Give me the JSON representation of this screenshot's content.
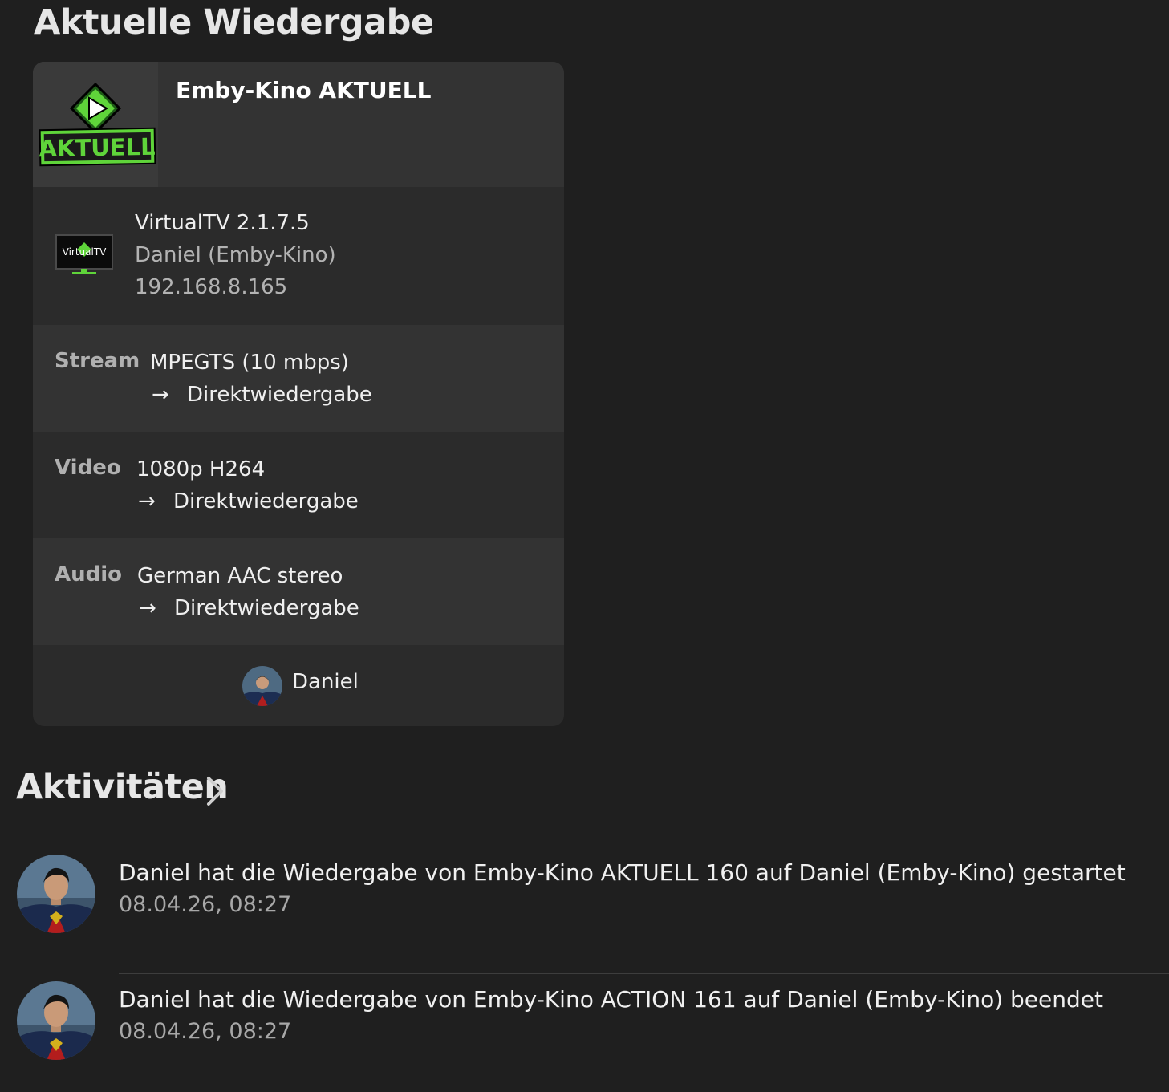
{
  "now_playing": {
    "section_title": "Aktuelle Wiedergabe",
    "item_title": "Emby-Kino AKTUELL",
    "thumb_text": "AKTUELL",
    "device": {
      "app": "VirtualTV 2.1.7.5",
      "device_name": "Daniel (Emby-Kino)",
      "ip": "192.168.8.165",
      "icon_text": "VirtualTV"
    },
    "stream": {
      "label": "Stream",
      "value": "MPEGTS (10 mbps)",
      "method": "Direktwiedergabe"
    },
    "video": {
      "label": "Video",
      "value": "1080p H264",
      "method": "Direktwiedergabe"
    },
    "audio": {
      "label": "Audio",
      "value": "German AAC stereo",
      "method": "Direktwiedergabe"
    },
    "arrow": "→",
    "user": "Daniel"
  },
  "activities": {
    "heading": "Aktivitäten",
    "items": [
      {
        "text": "Daniel hat die Wiedergabe von Emby-Kino AKTUELL 160 auf Daniel (Emby-Kino) gestartet",
        "time": "08.04.26, 08:27"
      },
      {
        "text": "Daniel hat die Wiedergabe von Emby-Kino ACTION 161 auf Daniel (Emby-Kino) beendet",
        "time": "08.04.26, 08:27"
      }
    ]
  },
  "colors": {
    "background": "#1f1f1f",
    "card_light": "#333333",
    "card_dark": "#2b2b2b",
    "accent_green": "#5fd43a"
  }
}
